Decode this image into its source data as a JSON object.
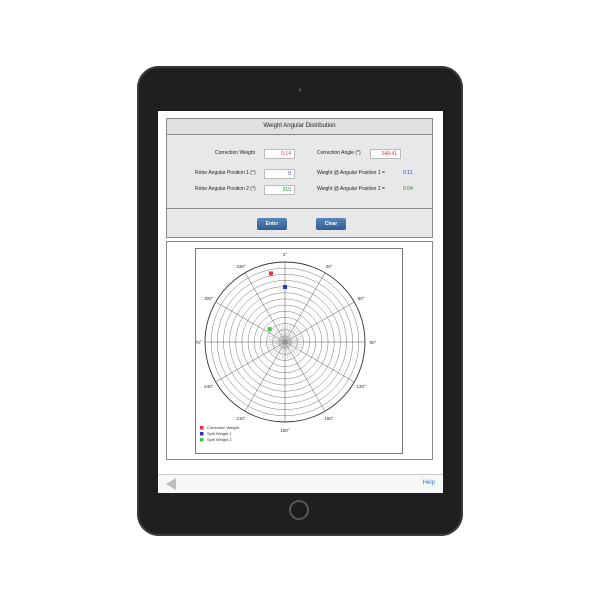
{
  "panel": {
    "title": "Weight Angular Distribution"
  },
  "form": {
    "correction_weight_label": "Correction Weight",
    "correction_weight_value": "0.14",
    "correction_angle_label": "Correction Angle (°)",
    "correction_angle_value": "348.41",
    "rotor_pos1_label": "Rotor Angular Position 1 (°)",
    "rotor_pos1_value": "0",
    "weight_pos1_label": "Weight @ Angular Position 1 =",
    "weight_pos1_value": "0.11",
    "rotor_pos2_label": "Rotor Angular Position 2 (°)",
    "rotor_pos2_value": "310",
    "weight_pos2_label": "Weight @ Angular Position 2 =",
    "weight_pos2_value": "0.04"
  },
  "buttons": {
    "enter_label": "Enter",
    "clear_label": "Clear"
  },
  "chart_data": {
    "type": "scatter",
    "polar": true,
    "angle_ticks": [
      "0°",
      "30°",
      "60°",
      "90°",
      "120°",
      "150°",
      "180°",
      "210°",
      "240°",
      "270°",
      "300°",
      "330°"
    ],
    "grid": true,
    "legend_placement": "bottom-left",
    "series": [
      {
        "name": "Correction Weight",
        "color": "#e8333a",
        "angle": 348.41,
        "r": 0.14
      },
      {
        "name": "Split Weight 1",
        "color": "#2a36c9",
        "angle": 0,
        "r": 0.11
      },
      {
        "name": "Split Weight 2",
        "color": "#39c84a",
        "angle": 310,
        "r": 0.04
      }
    ],
    "rmax": 0.16
  },
  "colors": {
    "correction_value": "#e8333a",
    "weight1_value": "#2a36c9",
    "weight2_value": "#1f8a3a",
    "help_link": "#2a7de1"
  },
  "bottom_bar": {
    "help_label": "Help",
    "back_icon": "back-arrow-icon"
  }
}
